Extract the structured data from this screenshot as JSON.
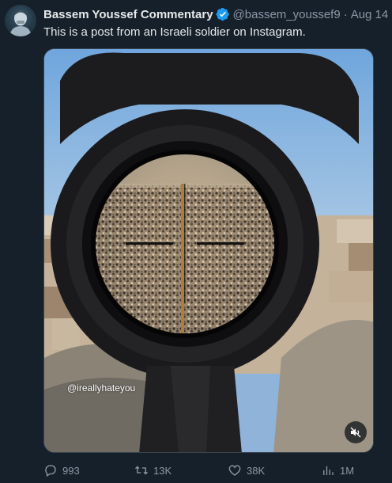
{
  "tweet": {
    "author_name": "Bassem Youssef Commentary",
    "handle": "@bassem_youssef9",
    "separator": "·",
    "time": "Aug 14",
    "text": "This is a post from an Israeli soldier on Instagram.",
    "verified": true
  },
  "media": {
    "watermark": "@ireallyhateyou",
    "muted": true
  },
  "actions": {
    "replies": "993",
    "retweets": "13K",
    "likes": "38K",
    "views": "1M"
  },
  "colors": {
    "background": "#15202b",
    "text": "#e7e9ea",
    "muted_text": "#8b98a5",
    "verified": "#1d9bf0"
  },
  "icons": {
    "avatar": "avatar",
    "verified": "verified-badge-icon",
    "mute": "speaker-muted-icon",
    "reply": "reply-icon",
    "retweet": "retweet-icon",
    "like": "heart-icon",
    "views": "views-chart-icon"
  }
}
